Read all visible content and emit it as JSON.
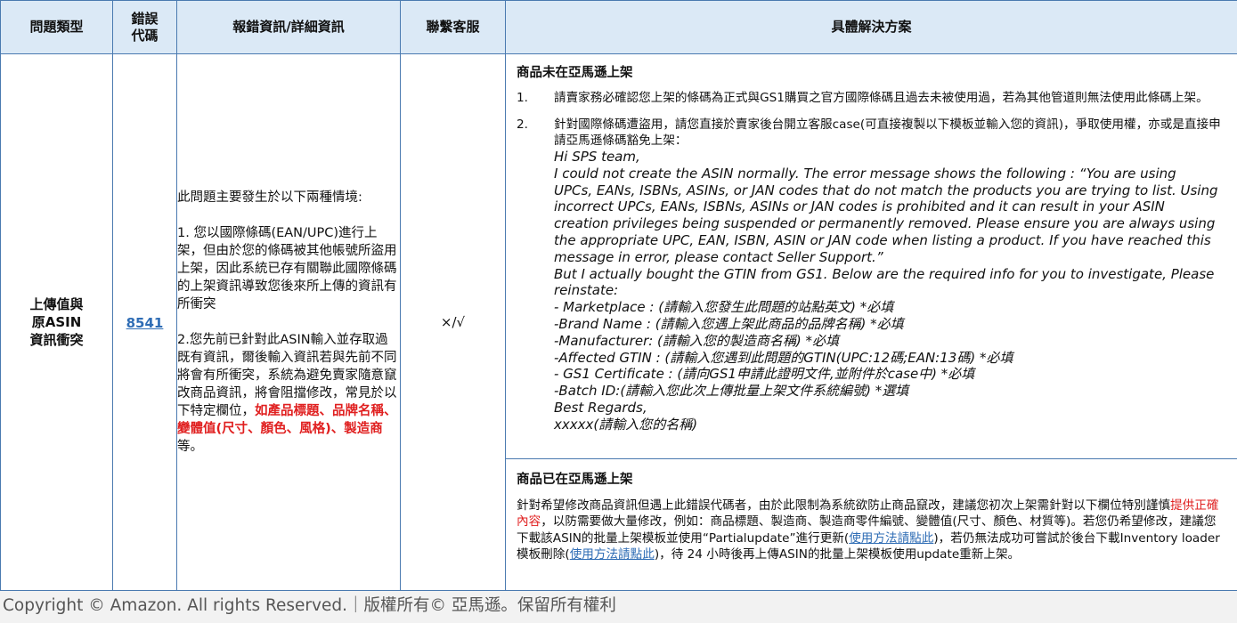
{
  "header": {
    "col_type": "問題類型",
    "col_code_line1": "錯誤",
    "col_code_line2": "代碼",
    "col_detail": "報錯資訊/詳細資訊",
    "col_contact": "聯繫客服",
    "col_solution": "具體解決方案"
  },
  "row": {
    "type_line1": "上傳值與",
    "type_line2": "原ASIN",
    "type_line3": "資訊衝突",
    "code": "8541",
    "detail": {
      "intro": "此問題主要發生於以下兩種情境:",
      "case1": "1. 您以國際條碼(EAN/UPC)進行上架，但由於您的條碼被其他帳號所盜用上架，因此系統已存有關聯此國際條碼的上架資訊導致您後來所上傳的資訊有所衝突",
      "case2_main": "2.您先前已針對此ASIN輸入並存取過既有資訊，爾後輸入資訊若與先前不同將會有所衝突，系統為避免賣家隨意竄改商品資訊，將會阻擋修改，常見於以下特定欄位，",
      "case2_red": "如產品標題、品牌名稱、變體值(尺寸、顏色、風格)、製造商",
      "case2_end": "等。"
    },
    "contact": "×/√",
    "solution_a": {
      "title": "商品未在亞馬遜上架",
      "item1_num": "1.",
      "item1_text": "請賣家務必確認您上架的條碼為正式與GS1購買之官方國際條碼且過去未被使用過，若為其他管道則無法使用此條碼上架。",
      "item2_num": "2.",
      "item2_text": "針對國際條碼遭盜用，請您直接於賣家後台開立客服case(可直接複製以下模板並輸入您的資訊)，爭取使用權，亦或是直接申請亞馬遜條碼豁免上架：",
      "template": [
        "Hi SPS team,",
        "I could not create the ASIN normally. The error message shows the following :  “You are using",
        "UPCs, EANs, ISBNs, ASINs, or JAN codes that do not match the products you are trying to list. Using",
        "incorrect UPCs, EANs, ISBNs, ASINs or JAN codes is prohibited and it can result in your ASIN",
        "creation privileges being suspended or permanently removed. Please ensure you are always using",
        "the appropriate UPC, EAN, ISBN, ASIN or JAN code when listing a product. If you have reached this",
        "message in error, please contact Seller Support.”",
        "But I actually bought the GTIN from GS1. Below are the required info for you to investigate, Please",
        "reinstate:",
        "- Marketplace : (請輸入您發生此問題的站點英文) *必填",
        "-Brand Name : (請輸入您遇上架此商品的品牌名稱) *必填",
        "-Manufacturer: (請輸入您的製造商名稱) *必填",
        "-Affected GTIN : (請輸入您遇到此問題的GTIN(UPC:12碼;EAN:13碼) *必填",
        "- GS1 Certificate : (請向GS1申請此證明文件,並附件於case中) *必填",
        "-Batch ID:(請輸入您此次上傳批量上架文件系統編號) *選填",
        "Best Regards,",
        "xxxxx(請輸入您的名稱)"
      ]
    },
    "solution_b": {
      "title": "商品已在亞馬遜上架",
      "p1": "針對希望修改商品資訊但遇上此錯誤代碼者，由於此限制為系統欲防止商品竄改，建議您初次上架需針對以下欄位特別謹慎",
      "p1_red": "提供正確內容",
      "p2": "，以防需要做大量修改，例如：商品標題、製造商、製造商零件編號、變體值(尺寸、顏色、材質等)。若您仍希望修改，建議您下載該ASIN的批量上架模板並使用“Partialupdate”進行更新(",
      "link1": "使用方法請點此",
      "p3": ")，若仍無法成功可嘗試於後台下載Inventory loader模板刪除(",
      "link2": "使用方法請點此",
      "p4": ")，待 24 小時後再上傳ASIN的批量上架模板使用update重新上架。"
    }
  },
  "footer": "Copyright © Amazon. All rights Reserved.｜版權所有© 亞馬遜。保留所有權利",
  "colors": {
    "header_bg": "#dbe9f6",
    "border": "#4a7ab0",
    "highlight_red": "#e01f1f",
    "link_blue": "#2f6db5"
  }
}
